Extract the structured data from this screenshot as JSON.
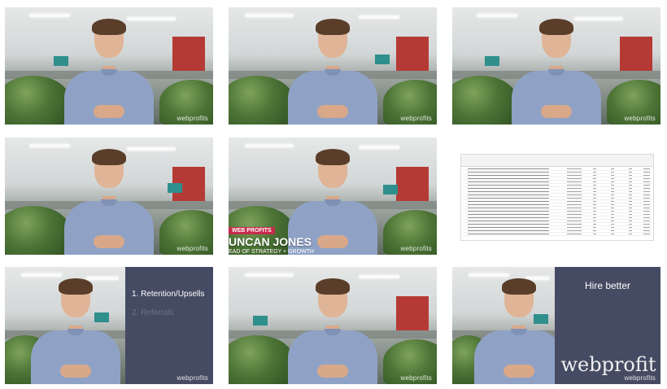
{
  "watermark": "webprofits",
  "lower_third": {
    "brand": "WEB PROFITS",
    "name": "UNCAN JONES",
    "title": "EAD OF STRATEGY + GROWTH"
  },
  "slide_retention": {
    "items": [
      "1. Retention/Upsells",
      "2. Referrals"
    ]
  },
  "slide_hire": {
    "title": "Hire better",
    "logo": "webprofit"
  },
  "colors": {
    "shirt": "#8fa2c6",
    "panel": "#454b62",
    "accent_red": "#c62b4b",
    "office_red": "#b53a36"
  }
}
